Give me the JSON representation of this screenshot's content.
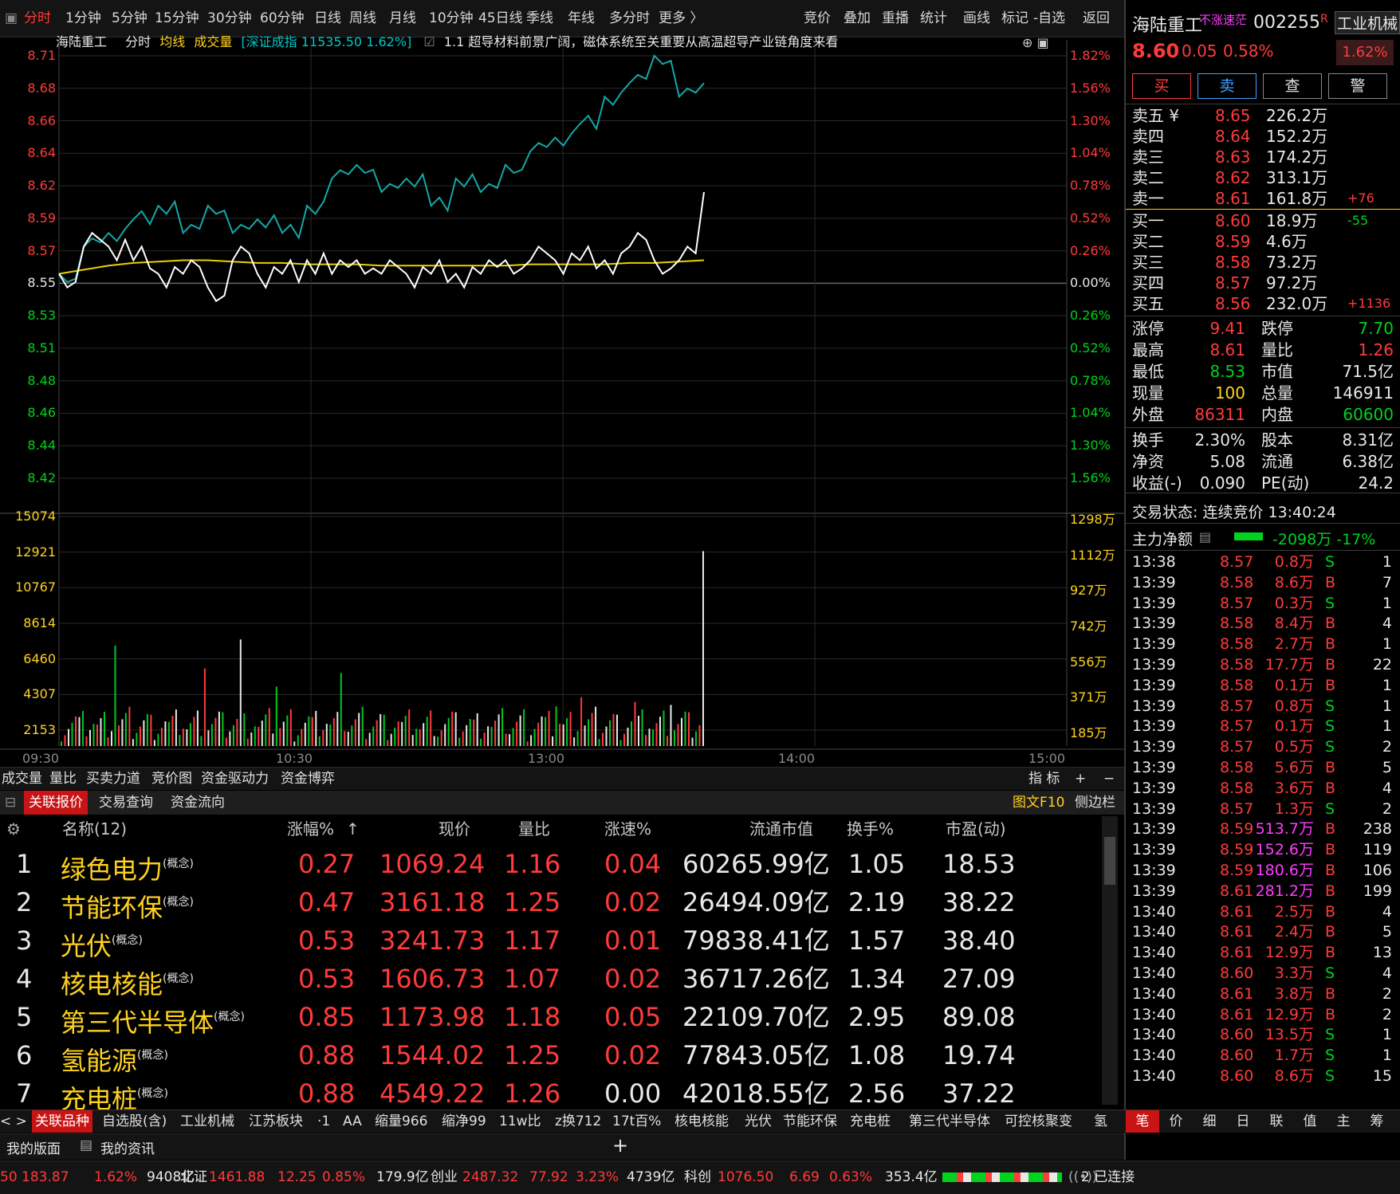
{
  "toolbar": {
    "periods": [
      "分时",
      "1分钟",
      "5分钟",
      "15分钟",
      "30分钟",
      "60分钟",
      "日线",
      "周线",
      "月线",
      "10分钟",
      "45日线",
      "季线",
      "年线",
      "多分时",
      "更多 〉"
    ],
    "actions": [
      "竞价",
      "叠加",
      "重播",
      "统计",
      "画线",
      "标记",
      "-自选",
      "返回"
    ]
  },
  "infobar": {
    "stock": "海陆重工",
    "mode": "分时",
    "avg_label": "均线",
    "vol_label": "成交量",
    "index_text": "[深证成指 11535.50 1.62%]",
    "news": "1.1 超导材料前景广阔，磁体系统至关重要从高温超导产业链角度来看"
  },
  "price_axis": {
    "left": [
      "8.71",
      "8.68",
      "8.66",
      "8.64",
      "8.62",
      "8.59",
      "8.57",
      "8.55",
      "8.53",
      "8.51",
      "8.48",
      "8.46",
      "8.44",
      "8.42"
    ],
    "right": [
      "1.82%",
      "1.56%",
      "1.30%",
      "1.04%",
      "0.78%",
      "0.52%",
      "0.26%",
      "0.00%",
      "0.26%",
      "0.52%",
      "0.78%",
      "1.04%",
      "1.30%",
      "1.56%"
    ]
  },
  "volume_axis": {
    "left": [
      "15074",
      "12921",
      "10767",
      "8614",
      "6460",
      "4307",
      "2153"
    ],
    "right": [
      "1298万",
      "1112万",
      "927万",
      "742万",
      "556万",
      "371万",
      "185万"
    ]
  },
  "time_axis": [
    "09:30",
    "10:30",
    "13:00",
    "14:00",
    "15:00"
  ],
  "chart_data": {
    "type": "line",
    "prev_close": 8.55,
    "ylim": [
      8.4,
      8.71
    ],
    "series": [
      {
        "name": "均线",
        "values": [
          8.55,
          8.553,
          8.556,
          8.558,
          8.559,
          8.56,
          8.56,
          8.559,
          8.558,
          8.558,
          8.557,
          8.557,
          8.557,
          8.556,
          8.556,
          8.556,
          8.556,
          8.556,
          8.556,
          8.557,
          8.557,
          8.557,
          8.557,
          8.558,
          8.558,
          8.559,
          8.56
        ]
      },
      {
        "name": "深证成指",
        "values": [
          8.55,
          8.57,
          8.58,
          8.59,
          8.6,
          8.58,
          8.6,
          8.58,
          8.59,
          8.58,
          8.6,
          8.62,
          8.63,
          8.61,
          8.62,
          8.6,
          8.62,
          8.61,
          8.63,
          8.64,
          8.65,
          8.66,
          8.68,
          8.69,
          8.71,
          8.68,
          8.69
        ]
      },
      {
        "name": "海陆重工",
        "values": [
          8.55,
          8.57,
          8.57,
          8.56,
          8.55,
          8.55,
          8.54,
          8.56,
          8.55,
          8.55,
          8.56,
          8.55,
          8.56,
          8.55,
          8.55,
          8.55,
          8.55,
          8.55,
          8.56,
          8.56,
          8.56,
          8.56,
          8.56,
          8.57,
          8.56,
          8.56,
          8.61
        ]
      }
    ],
    "volume_max": 15074,
    "volume_last_bar": 12800
  },
  "table_tabs": {
    "indicator_tabs": [
      "成交量",
      "量比",
      "买卖力道",
      "竞价图",
      "资金驱动力",
      "资金博弈"
    ],
    "indicator_right": [
      "指 标",
      "+",
      "−"
    ],
    "list_tabs": [
      "关联报价",
      "交易查询",
      "资金流向"
    ],
    "list_right": [
      "图文F10",
      "侧边栏"
    ]
  },
  "related": {
    "headers": [
      "名称(12)",
      "涨幅%",
      "现价",
      "量比",
      "涨速%",
      "流通市值",
      "换手%",
      "市盈(动)"
    ],
    "rows": [
      {
        "idx": "1",
        "name": "绿色电力",
        "tag": "(概念)",
        "chg": "0.27",
        "price": "1069.24",
        "vr": "1.16",
        "speed": "0.04",
        "cap": "60265.99亿",
        "turn": "1.05",
        "pe": "18.53"
      },
      {
        "idx": "2",
        "name": "节能环保",
        "tag": "(概念)",
        "chg": "0.47",
        "price": "3161.18",
        "vr": "1.25",
        "speed": "0.02",
        "cap": "26494.09亿",
        "turn": "2.19",
        "pe": "38.22"
      },
      {
        "idx": "3",
        "name": "光伏",
        "tag": "(概念)",
        "chg": "0.53",
        "price": "3241.73",
        "vr": "1.17",
        "speed": "0.01",
        "cap": "79838.41亿",
        "turn": "1.57",
        "pe": "38.40"
      },
      {
        "idx": "4",
        "name": "核电核能",
        "tag": "(概念)",
        "chg": "0.53",
        "price": "1606.73",
        "vr": "1.07",
        "speed": "0.02",
        "cap": "36717.26亿",
        "turn": "1.34",
        "pe": "27.09"
      },
      {
        "idx": "5",
        "name": "第三代半导体",
        "tag": "(概念)",
        "chg": "0.85",
        "price": "1173.98",
        "vr": "1.18",
        "speed": "0.05",
        "cap": "22109.70亿",
        "turn": "2.95",
        "pe": "89.08"
      },
      {
        "idx": "6",
        "name": "氢能源",
        "tag": "(概念)",
        "chg": "0.88",
        "price": "1544.02",
        "vr": "1.25",
        "speed": "0.02",
        "cap": "77843.05亿",
        "turn": "1.08",
        "pe": "19.74"
      },
      {
        "idx": "7",
        "name": "充电桩",
        "tag": "(概念)",
        "chg": "0.88",
        "price": "4549.22",
        "vr": "1.26",
        "speed": "0.00",
        "cap": "42018.55亿",
        "turn": "2.56",
        "pe": "37.22"
      }
    ]
  },
  "tagbar": [
    "< >",
    "关联品种",
    "自选股(含)",
    "工业机械",
    "江苏板块",
    "·1",
    "AA",
    "缩量966",
    "缩净99",
    "11w比",
    "z换712",
    "17t百%",
    "核电核能",
    "光伏",
    "节能环保",
    "充电桩",
    "第三代半导体",
    "可控核聚变",
    "氢"
  ],
  "layoutbar": {
    "a": "我的版面",
    "b": "我的资讯",
    "plus": "+"
  },
  "statusbar": [
    {
      "t": "50 183.87",
      "c": "red"
    },
    {
      "t": "1.62%",
      "c": "red"
    },
    {
      "t": "9408亿",
      "c": "white"
    },
    {
      "t": "北证",
      "c": "white"
    },
    {
      "t": "1461.88",
      "c": "red"
    },
    {
      "t": "12.25",
      "c": "red"
    },
    {
      "t": "0.85%",
      "c": "red"
    },
    {
      "t": "179.9亿",
      "c": "white"
    },
    {
      "t": "创业",
      "c": "white"
    },
    {
      "t": "2487.32",
      "c": "red"
    },
    {
      "t": "77.92",
      "c": "red"
    },
    {
      "t": "3.23%",
      "c": "red"
    },
    {
      "t": "4739亿",
      "c": "white"
    },
    {
      "t": "科创",
      "c": "white"
    },
    {
      "t": "1076.50",
      "c": "red"
    },
    {
      "t": "6.69",
      "c": "red"
    },
    {
      "t": "0.63%",
      "c": "red"
    },
    {
      "t": "353.4亿",
      "c": "white"
    },
    {
      "t": "2 已连接",
      "c": "white"
    }
  ],
  "quote": {
    "name": "海陆重工",
    "tag": "不涨速茫",
    "code": "002255",
    "r": "R",
    "sector": "工业机械",
    "price": "8.60",
    "chg": "0.05",
    "pct": "0.58%",
    "sector_pct": "1.62%",
    "buttons": [
      "买",
      "卖",
      "查",
      "警"
    ],
    "asks": [
      {
        "l": "卖五 ¥",
        "p": "8.65",
        "v": "226.2万",
        "d": ""
      },
      {
        "l": "卖四",
        "p": "8.64",
        "v": "152.2万",
        "d": ""
      },
      {
        "l": "卖三",
        "p": "8.63",
        "v": "174.2万",
        "d": ""
      },
      {
        "l": "卖二",
        "p": "8.62",
        "v": "313.1万",
        "d": ""
      },
      {
        "l": "卖一",
        "p": "8.61",
        "v": "161.8万",
        "d": "+76"
      }
    ],
    "bids": [
      {
        "l": "买一",
        "p": "8.60",
        "v": "18.9万",
        "d": "-55"
      },
      {
        "l": "买二",
        "p": "8.59",
        "v": "4.6万",
        "d": ""
      },
      {
        "l": "买三",
        "p": "8.58",
        "v": "73.2万",
        "d": ""
      },
      {
        "l": "买四",
        "p": "8.57",
        "v": "97.2万",
        "d": ""
      },
      {
        "l": "买五",
        "p": "8.56",
        "v": "232.0万",
        "d": "+1136"
      }
    ],
    "stats1": [
      {
        "a": "涨停",
        "av": "9.41",
        "ac": "red",
        "b": "跌停",
        "bv": "7.70",
        "bc": "green"
      },
      {
        "a": "最高",
        "av": "8.61",
        "ac": "red",
        "b": "量比",
        "bv": "1.26",
        "bc": "red"
      },
      {
        "a": "最低",
        "av": "8.53",
        "ac": "green",
        "b": "市值",
        "bv": "71.5亿",
        "bc": "white"
      },
      {
        "a": "现量",
        "av": "100",
        "ac": "yellow",
        "b": "总量",
        "bv": "146911",
        "bc": "white"
      },
      {
        "a": "外盘",
        "av": "86311",
        "ac": "red",
        "b": "内盘",
        "bv": "60600",
        "bc": "green"
      }
    ],
    "stats2": [
      {
        "a": "换手",
        "av": "2.30%",
        "b": "股本",
        "bv": "8.31亿"
      },
      {
        "a": "净资",
        "av": "5.08",
        "b": "流通",
        "bv": "6.38亿"
      },
      {
        "a": "收益(-)",
        "av": "0.090",
        "b": "PE(动)",
        "bv": "24.2"
      }
    ],
    "status_label": "交易状态: 连续竞价 13:40:24",
    "mainflow_label": "主力净额",
    "mainflow_value": "-2098万 -17%",
    "ticks": [
      [
        "13:38",
        "8.57",
        "0.8万",
        "S",
        "1"
      ],
      [
        "13:39",
        "8.58",
        "8.6万",
        "B",
        "7"
      ],
      [
        "13:39",
        "8.57",
        "0.3万",
        "S",
        "1"
      ],
      [
        "13:39",
        "8.58",
        "8.4万",
        "B",
        "4"
      ],
      [
        "13:39",
        "8.58",
        "2.7万",
        "B",
        "1"
      ],
      [
        "13:39",
        "8.58",
        "17.7万",
        "B",
        "22"
      ],
      [
        "13:39",
        "8.58",
        "0.1万",
        "B",
        "1"
      ],
      [
        "13:39",
        "8.57",
        "0.8万",
        "S",
        "1"
      ],
      [
        "13:39",
        "8.57",
        "0.1万",
        "S",
        "1"
      ],
      [
        "13:39",
        "8.57",
        "0.5万",
        "S",
        "2"
      ],
      [
        "13:39",
        "8.58",
        "5.6万",
        "B",
        "5"
      ],
      [
        "13:39",
        "8.58",
        "3.6万",
        "B",
        "4"
      ],
      [
        "13:39",
        "8.57",
        "1.3万",
        "S",
        "2"
      ],
      [
        "13:39",
        "8.59",
        "513.7万",
        "B",
        "238"
      ],
      [
        "13:39",
        "8.59",
        "152.6万",
        "B",
        "119"
      ],
      [
        "13:39",
        "8.59",
        "180.6万",
        "B",
        "106"
      ],
      [
        "13:39",
        "8.61",
        "281.2万",
        "B",
        "199"
      ],
      [
        "13:40",
        "8.61",
        "2.5万",
        "B",
        "4"
      ],
      [
        "13:40",
        "8.61",
        "2.4万",
        "B",
        "5"
      ],
      [
        "13:40",
        "8.61",
        "12.9万",
        "B",
        "13"
      ],
      [
        "13:40",
        "8.60",
        "3.3万",
        "S",
        "4"
      ],
      [
        "13:40",
        "8.61",
        "3.8万",
        "B",
        "2"
      ],
      [
        "13:40",
        "8.61",
        "12.9万",
        "B",
        "2"
      ],
      [
        "13:40",
        "8.60",
        "13.5万",
        "S",
        "1"
      ],
      [
        "13:40",
        "8.60",
        "1.7万",
        "S",
        "1"
      ],
      [
        "13:40",
        "8.60",
        "8.6万",
        "S",
        "15"
      ]
    ],
    "rtabs": [
      "笔",
      "价",
      "细",
      "日",
      "联",
      "值",
      "主",
      "筹"
    ]
  }
}
